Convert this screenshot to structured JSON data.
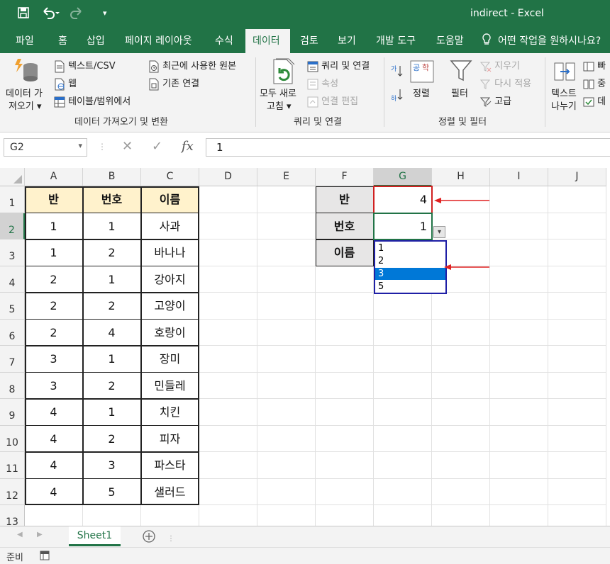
{
  "titlebar": {
    "title": "indirect  -  Excel"
  },
  "tabs": [
    "파일",
    "홈",
    "삽입",
    "페이지 레이아웃",
    "수식",
    "데이터",
    "검토",
    "보기",
    "개발 도구",
    "도움말",
    "어떤 작업을 원하시나요?"
  ],
  "active_tab": "데이터",
  "ribbon": {
    "get_data": {
      "line1": "데이터 가",
      "line2": "져오기"
    },
    "text_csv": "텍스트/CSV",
    "web": "웹",
    "from_table": "테이블/범위에서",
    "recent_sources": "최근에 사용한 원본",
    "existing_conn": "기존 연결",
    "group1_label": "데이터 가져오기 및 변환",
    "refresh_all": {
      "line1": "모두 새로",
      "line2": "고침"
    },
    "queries_conn": "쿼리 및 연결",
    "properties": "속성",
    "edit_links": "연결 편집",
    "group2_label": "쿼리 및 연결",
    "sort": "정렬",
    "filter": "필터",
    "clear": "지우기",
    "reapply": "다시 적용",
    "advanced": "고급",
    "group3_label": "정렬 및 필터",
    "text_to_cols": {
      "line1": "텍스트",
      "line2": "나누기"
    },
    "flash_fill": "빠",
    "remove_dup": "중",
    "validate": "데"
  },
  "formula_bar": {
    "name_box": "G2",
    "value": "1"
  },
  "columns": [
    "A",
    "B",
    "C",
    "D",
    "E",
    "F",
    "G",
    "H",
    "I",
    "J"
  ],
  "rows": [
    "1",
    "2",
    "3",
    "4",
    "5",
    "6",
    "7",
    "8",
    "9",
    "10",
    "11",
    "12",
    "13"
  ],
  "table": {
    "headers": [
      "반",
      "번호",
      "이름"
    ],
    "rows": [
      [
        "1",
        "1",
        "사과"
      ],
      [
        "1",
        "2",
        "바나나"
      ],
      [
        "2",
        "1",
        "강아지"
      ],
      [
        "2",
        "2",
        "고양이"
      ],
      [
        "2",
        "4",
        "호랑이"
      ],
      [
        "3",
        "1",
        "장미"
      ],
      [
        "3",
        "2",
        "민들레"
      ],
      [
        "4",
        "1",
        "치킨"
      ],
      [
        "4",
        "2",
        "피자"
      ],
      [
        "4",
        "3",
        "파스타"
      ],
      [
        "4",
        "5",
        "샐러드"
      ]
    ]
  },
  "lookup": {
    "labels": [
      "반",
      "번호",
      "이름"
    ],
    "values": [
      "4",
      "1",
      ""
    ]
  },
  "dropdown": {
    "options": [
      "1",
      "2",
      "3",
      "5"
    ],
    "highlighted": "3"
  },
  "sheet_tab": "Sheet1",
  "status": "준비",
  "colors": {
    "excel_green": "#217346",
    "header_fill": "#fff2cc",
    "label_fill": "#e7e6e6",
    "annotation_red": "#e02020",
    "dropdown_border": "#1f1fa6",
    "selection_blue": "#0078d7"
  }
}
